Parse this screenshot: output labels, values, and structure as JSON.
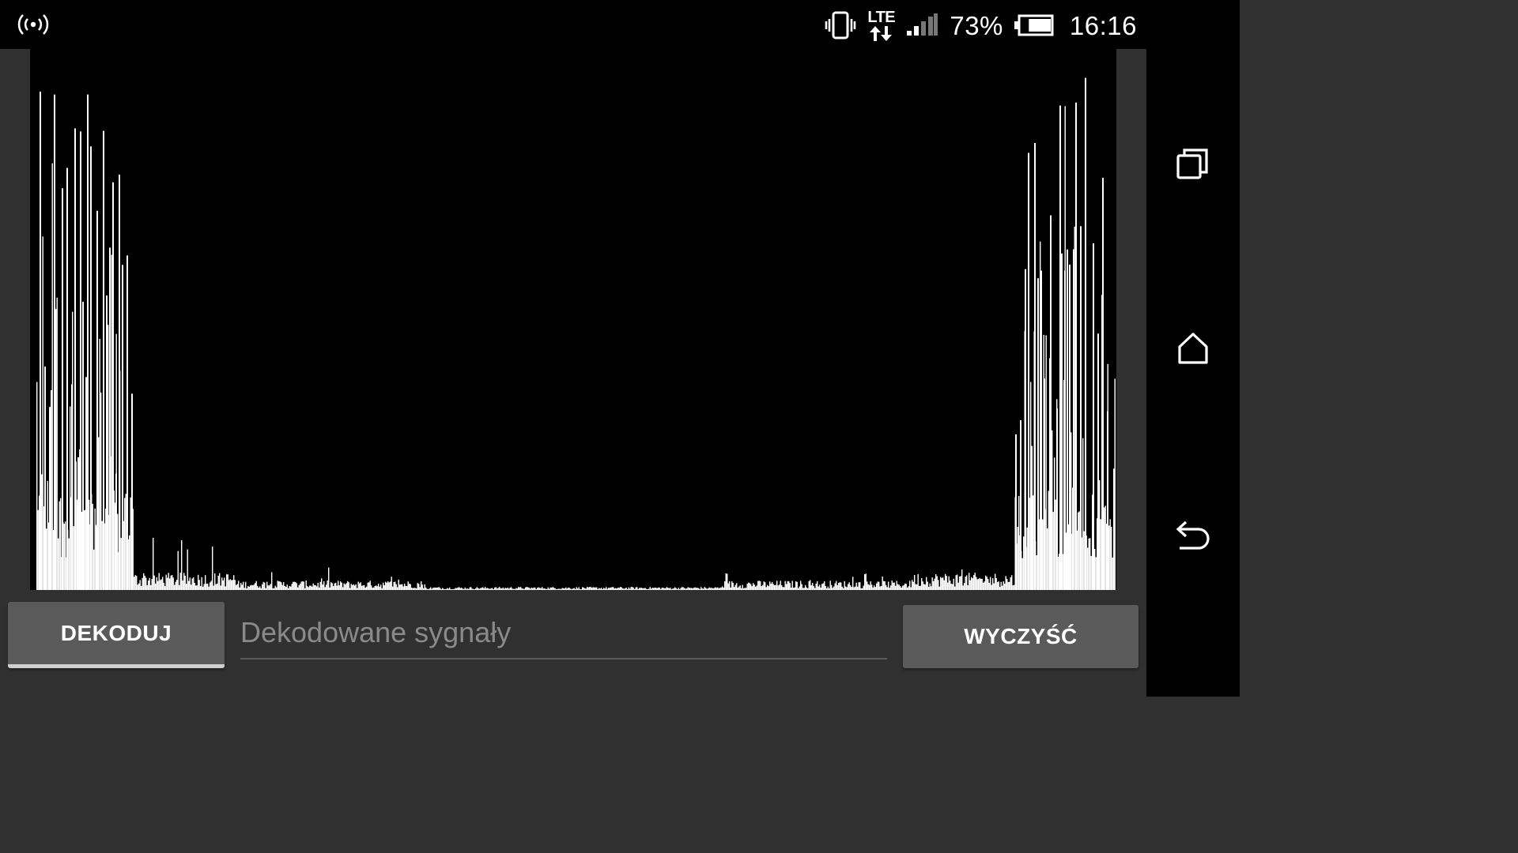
{
  "status_bar": {
    "hotspot_icon": "wifi-hotspot-icon",
    "vibrate_icon": "vibrate-icon",
    "network_type": "LTE",
    "signal_icon": "signal-strength-icon",
    "battery_percent": "73%",
    "battery_icon": "battery-icon",
    "battery_level": 0.73,
    "time": "16:16"
  },
  "nav_bar": {
    "recents_icon": "recents-icon",
    "home_icon": "home-icon",
    "back_icon": "back-icon"
  },
  "spectrum": {
    "background": "#000000",
    "bar_color": "#ffffff"
  },
  "controls": {
    "decode_label": "DEKODUJ",
    "decoded_placeholder": "Dekodowane sygnały",
    "decoded_value": "",
    "clear_label": "WYCZYŚĆ"
  },
  "colors": {
    "app_background": "#303030",
    "button": "#5a5a5a",
    "system_bars": "#000000"
  }
}
